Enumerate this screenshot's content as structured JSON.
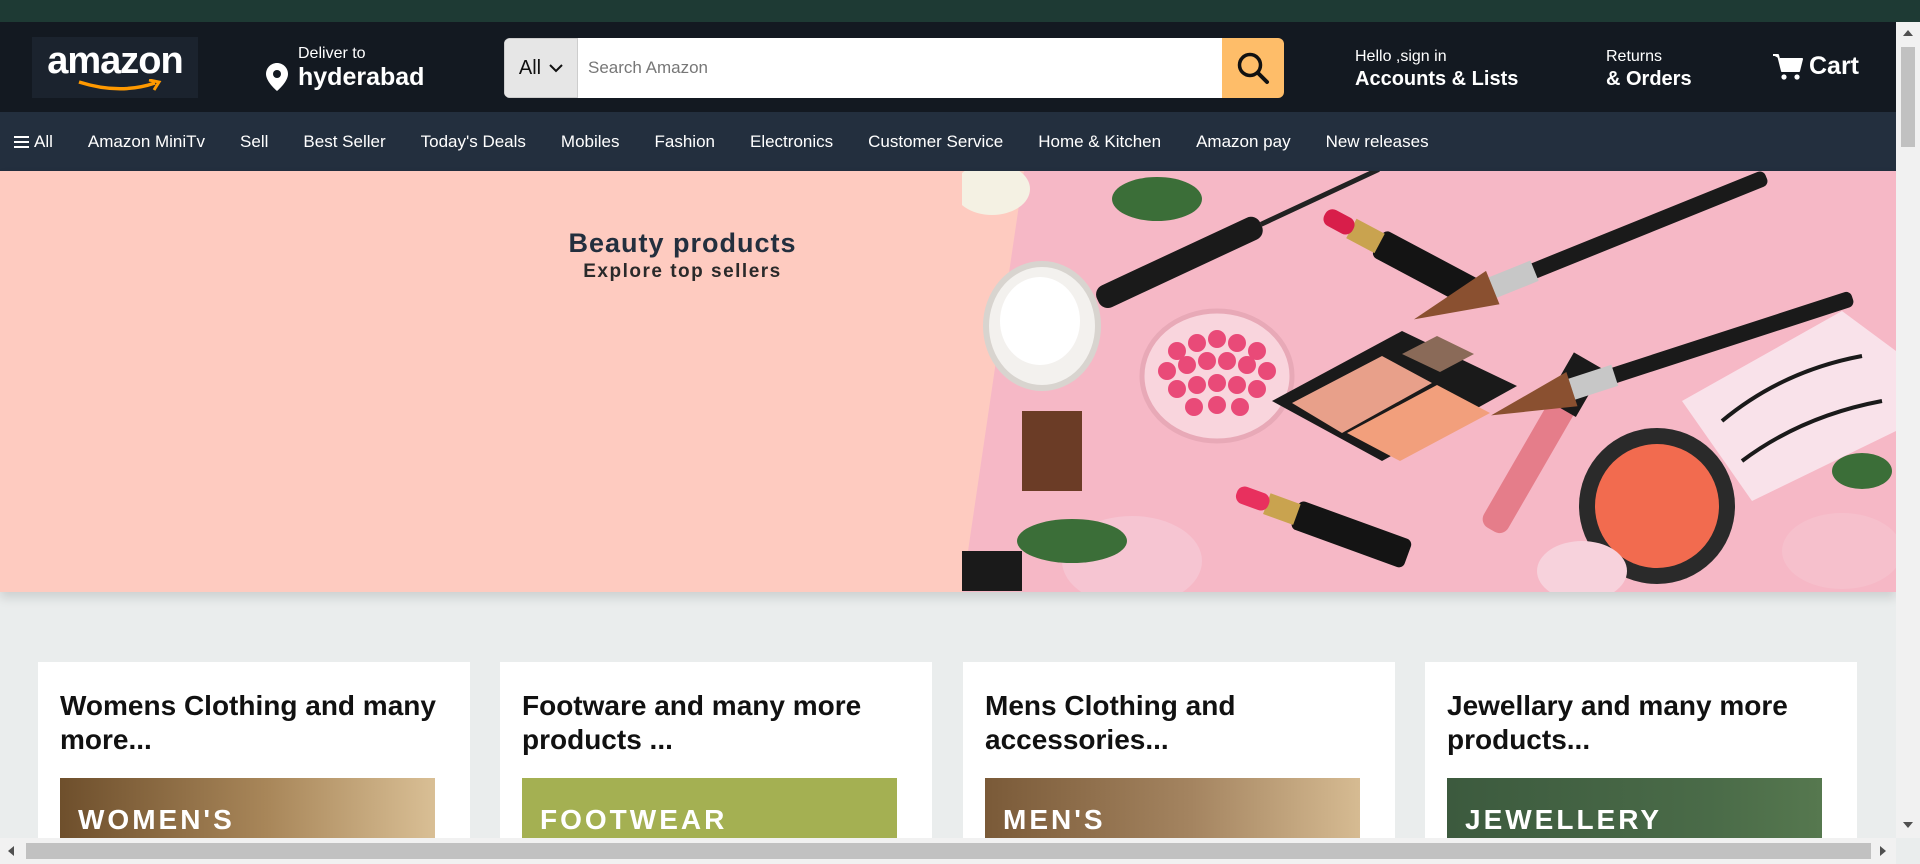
{
  "header": {
    "logo_text": "amazon",
    "deliver_label": "Deliver to",
    "deliver_city": "hyderabad",
    "search": {
      "category": "All",
      "placeholder": "Search Amazon"
    },
    "account_greeting": "Hello ,sign in",
    "account_title": "Accounts & Lists",
    "returns_label": "Returns",
    "orders_label": "& Orders",
    "cart_label": "Cart"
  },
  "subnav": {
    "all_label": "All",
    "items": [
      "Amazon MiniTv",
      "Sell",
      "Best Seller",
      "Today's Deals",
      "Mobiles",
      "Fashion",
      "Electronics",
      "Customer Service",
      "Home & Kitchen",
      "Amazon pay",
      "New releases"
    ]
  },
  "hero": {
    "title": "Beauty products",
    "subtitle": "Explore top sellers"
  },
  "cards": [
    {
      "title": "Womens Clothing and many more...",
      "image_text": "WOMEN'S",
      "image_color": "#7a5a35"
    },
    {
      "title": "Footware and many more products ...",
      "image_text": "FOOTWEAR",
      "image_color": "#a4b052"
    },
    {
      "title": "Mens Clothing and accessories...",
      "image_text": "MEN'S",
      "image_color": "#8a6a45"
    },
    {
      "title": "Jewellary and many more products...",
      "image_text": "JEWELLERY",
      "image_color": "#3f5a40"
    }
  ],
  "colors": {
    "header_bg": "#131921",
    "subnav_bg": "#232f3e",
    "search_button": "#febd69",
    "hero_bg": "#fecbc0",
    "accent_orange": "#f90"
  }
}
